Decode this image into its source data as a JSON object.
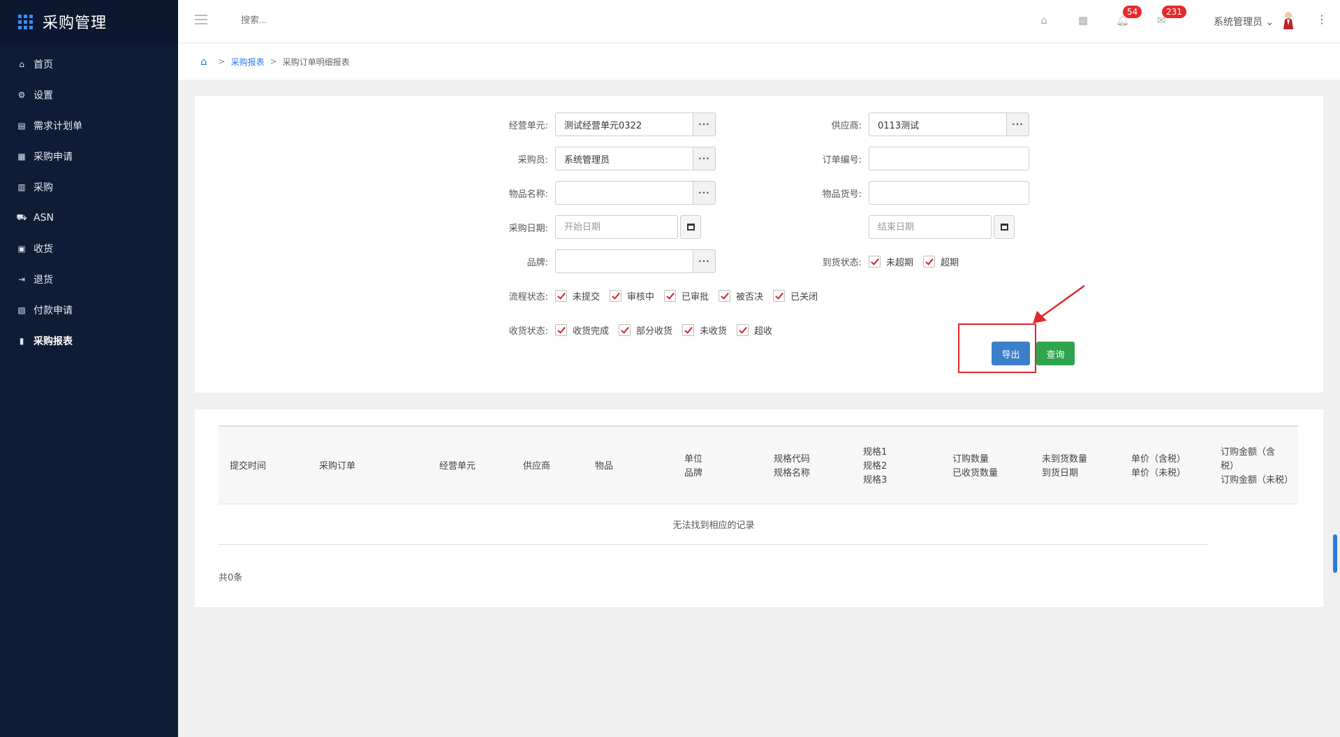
{
  "sidebar": {
    "title": "采购管理",
    "items": [
      {
        "label": "首页",
        "icon": "⌂"
      },
      {
        "label": "设置",
        "icon": "⚙"
      },
      {
        "label": "需求计划单",
        "icon": "▤"
      },
      {
        "label": "采购申请",
        "icon": "▦"
      },
      {
        "label": "采购",
        "icon": "▥"
      },
      {
        "label": "ASN",
        "icon": "⛟"
      },
      {
        "label": "收货",
        "icon": "▣"
      },
      {
        "label": "退货",
        "icon": "⇥"
      },
      {
        "label": "付款申请",
        "icon": "▧"
      },
      {
        "label": "采购报表",
        "icon": "▮"
      }
    ]
  },
  "header": {
    "search_placeholder": "搜索...",
    "bell_badge": "54",
    "mail_badge": "231",
    "user_name": "系统管理员"
  },
  "breadcrumb": {
    "parent": "采购报表",
    "current": "采购订单明细报表"
  },
  "filters": {
    "business_unit": {
      "label": "经营单元:",
      "value": "测试经营单元0322"
    },
    "supplier": {
      "label": "供应商:",
      "value": "0113测试"
    },
    "buyer": {
      "label": "采购员:",
      "value": "系统管理员"
    },
    "order_no": {
      "label": "订单编号:",
      "value": ""
    },
    "item_name": {
      "label": "物品名称:",
      "value": ""
    },
    "item_code": {
      "label": "物品货号:",
      "value": ""
    },
    "purchase_date": {
      "label": "采购日期:",
      "start_placeholder": "开始日期",
      "end_placeholder": "结束日期"
    },
    "brand": {
      "label": "品牌:",
      "value": ""
    },
    "arrival_status": {
      "label": "到货状态:",
      "options": [
        "未超期",
        "超期"
      ]
    },
    "flow_status": {
      "label": "流程状态:",
      "options": [
        "未提交",
        "审核中",
        "已审批",
        "被否决",
        "已关闭"
      ]
    },
    "receive_status": {
      "label": "收货状态:",
      "options": [
        "收货完成",
        "部分收货",
        "未收货",
        "超收"
      ]
    }
  },
  "buttons": {
    "export": "导出",
    "query": "查询"
  },
  "table": {
    "columns": [
      "提交时间",
      "采购订单",
      "经营单元",
      "供应商",
      "物品",
      "单位\n品牌",
      "规格代码\n规格名称",
      "规格1\n规格2\n规格3",
      "订购数量\n已收货数量",
      "未到货数量\n到货日期",
      "单价（含税）\n单价（未税）",
      "订购金额（含税）\n订购金额（未税）"
    ],
    "empty_text": "无法找到相应的记录",
    "total": "共0条"
  },
  "colors": {
    "sidebar_bg": "#0e1c35",
    "export_btn": "#3d7fc9",
    "query_btn": "#2ea44f",
    "highlight": "#e3262c"
  }
}
